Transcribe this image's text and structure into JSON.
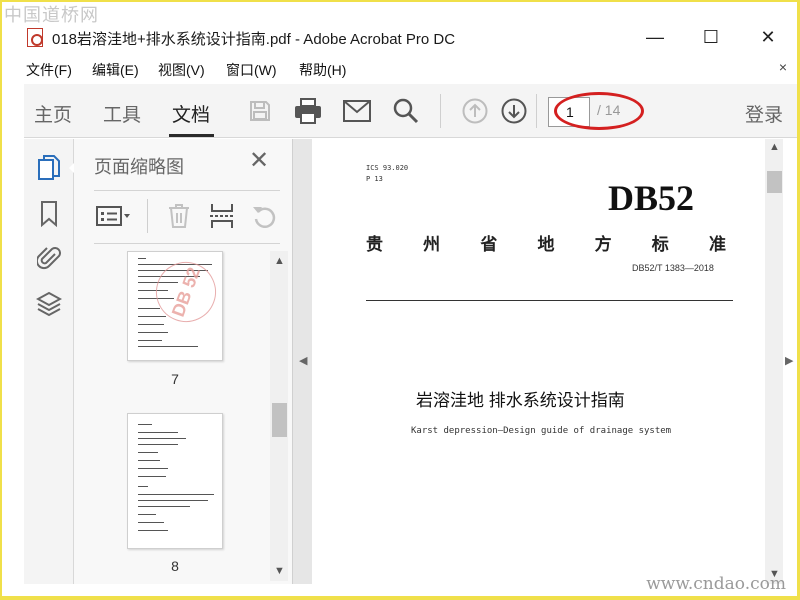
{
  "watermark": {
    "top_left": "中国道桥网",
    "bottom_right": "www.cndao.com"
  },
  "window": {
    "title": "018岩溶洼地+排水系统设计指南.pdf - Adobe Acrobat Pro DC",
    "minimize": "—",
    "maximize": "☐",
    "close": "✕"
  },
  "menu": {
    "items": [
      "文件(F)",
      "编辑(E)",
      "视图(V)",
      "窗口(W)",
      "帮助(H)"
    ],
    "close": "×"
  },
  "toolbar": {
    "tabs": [
      "主页",
      "工具",
      "文档"
    ],
    "active_tab": "文档",
    "icons": [
      "save-icon",
      "print-icon",
      "email-icon",
      "search-icon",
      "page-up-icon",
      "page-down-icon"
    ],
    "page_current": "1",
    "page_total": "/ 14",
    "login": "登录"
  },
  "rail": {
    "icons": [
      "page-thumbnails-icon",
      "bookmark-icon",
      "attachment-icon",
      "layers-icon"
    ]
  },
  "panel": {
    "title": "页面缩略图",
    "close": "✕",
    "tools": [
      "options-menu-icon",
      "delete-icon",
      "insert-page-icon",
      "rotate-icon"
    ],
    "thumbnails": [
      {
        "page": "7",
        "stamp": "DB 52"
      },
      {
        "page": "8"
      }
    ]
  },
  "document": {
    "ics": "ICS 93.020",
    "p": "P 13",
    "code": "DB52",
    "province_chars": [
      "贵",
      "州",
      "省",
      "地",
      "方",
      "标",
      "准"
    ],
    "std_number": "DB52/T 1383—2018",
    "title": "岩溶洼地  排水系统设计指南",
    "subtitle": "Karst depression—Design guide of drainage system"
  },
  "colors": {
    "accent_red": "#d42020",
    "border_yellow": "#f0e04a",
    "link_blue": "#2a6ebb"
  }
}
